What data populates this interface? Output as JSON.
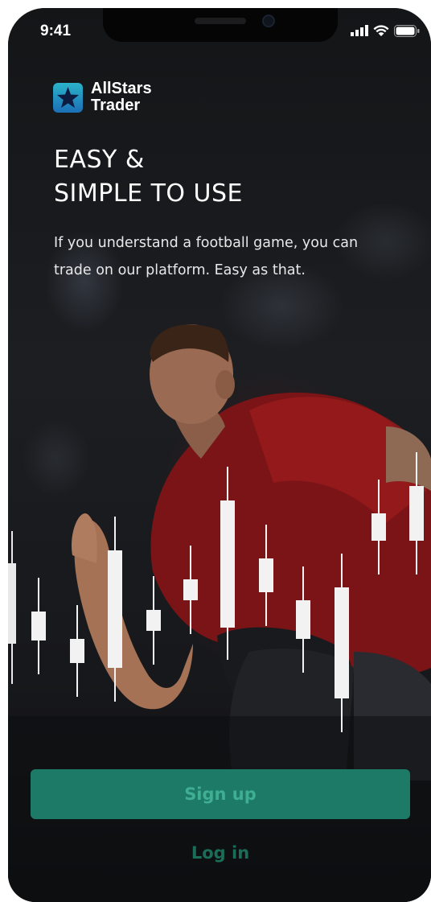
{
  "status_bar": {
    "time": "9:41",
    "icons": [
      "signal-icon",
      "wifi-icon",
      "battery-icon"
    ]
  },
  "brand": {
    "name_line1": "AllStars",
    "name_line2": "Trader",
    "logo_icon": "star-logo-icon",
    "colors": {
      "logo_top": "#2bb3c9",
      "logo_bottom": "#1b6fb6",
      "star": "#0d1b3f"
    }
  },
  "hero": {
    "headline_line1": "EASY &",
    "headline_line2": "SIMPLE TO USE",
    "description": "If you understand a football game, you can trade on our platform. Easy as that."
  },
  "actions": {
    "signup_label": "Sign up",
    "login_label": "Log in"
  },
  "colors": {
    "accent": "#1c7a66",
    "accent_text": "#3fae93",
    "login_text": "#1a6d57",
    "candle": "#f2f2f2"
  }
}
